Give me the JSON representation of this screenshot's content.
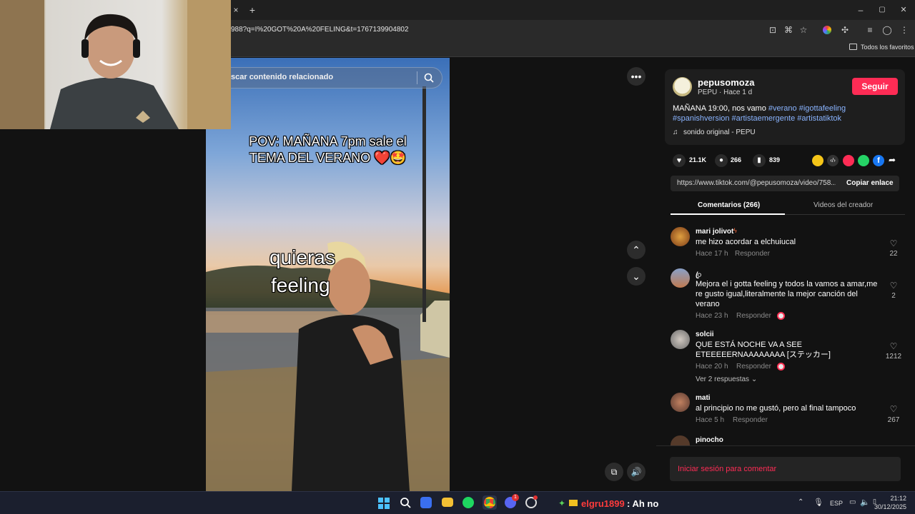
{
  "browser": {
    "url": "988?q=I%20GOT%20A%20FELING&t=1767139904802",
    "bookmarks_label": "Todos los favoritos",
    "new_tab": "+",
    "close_tab": "×",
    "window_min": "–",
    "window_max": "▢",
    "window_close": "✕"
  },
  "video": {
    "search_placeholder": "scar contenido relacionado",
    "caption_line1": "POV: MAÑANA 7pm sale el",
    "caption_line2": "TEMA DEL VERANO ❤️🤩",
    "lyric1": "quieras",
    "lyric2": "feeling"
  },
  "post": {
    "username": "pepusomoza",
    "subtitle": "PEPU · Hace 1 d",
    "follow_label": "Seguir",
    "description_text": "MAÑANA 19:00, nos vamo ",
    "hashtags_line1": "#verano #igottafeeling",
    "hashtags_line2": "#spanishversion #artistaemergente #artistatiktok",
    "sound": "sonido original - PEPU",
    "likes": "21.1K",
    "comments": "266",
    "saves": "839",
    "link": "https://www.tiktok.com/@pepusomoza/video/758...",
    "copy_label": "Copiar enlace"
  },
  "tabs": {
    "comments": "Comentarios (266)",
    "creator_videos": "Videos del creador"
  },
  "comments": [
    {
      "name": "mari jolivot",
      "text": "me hizo acordar a elchuiucal",
      "time": "Hace 17 h",
      "reply": "Responder",
      "likes": "22"
    },
    {
      "name": "ꦿ",
      "text": "Mejora el i gotta feeling y todos la vamos a amar,me re gusto igual,literalmente la mejor canción del verano",
      "time": "Hace 23 h",
      "reply": "Responder",
      "likes": "2"
    },
    {
      "name": "solcii",
      "text": "QUE ESTÁ NOCHE VA A SEE ETEEEEERNAAAAAAAA [ステッカー]",
      "time": "Hace 20 h",
      "reply": "Responder",
      "likes": "1212",
      "more": "Ver 2 respuestas"
    },
    {
      "name": "mati",
      "text": "al principio no me gustó, pero al final tampoco",
      "time": "Hace 5 h",
      "reply": "Responder",
      "likes": "267"
    },
    {
      "name": "pinocho",
      "text": "",
      "time": "",
      "reply": "",
      "likes": ""
    }
  ],
  "login_prompt": "Iniciar sesión para comentar",
  "taskbar": {
    "chat_user": "elgru1899",
    "chat_msg": ": Ah no",
    "lang": "ESP",
    "time": "21:12",
    "date": "30/12/2025",
    "discord_badge": "1"
  },
  "colors": {
    "accent": "#fe2c55",
    "hashtag": "#8ab4ff",
    "panel_bg": "#121212",
    "chat_user": "#ff3b3b"
  }
}
